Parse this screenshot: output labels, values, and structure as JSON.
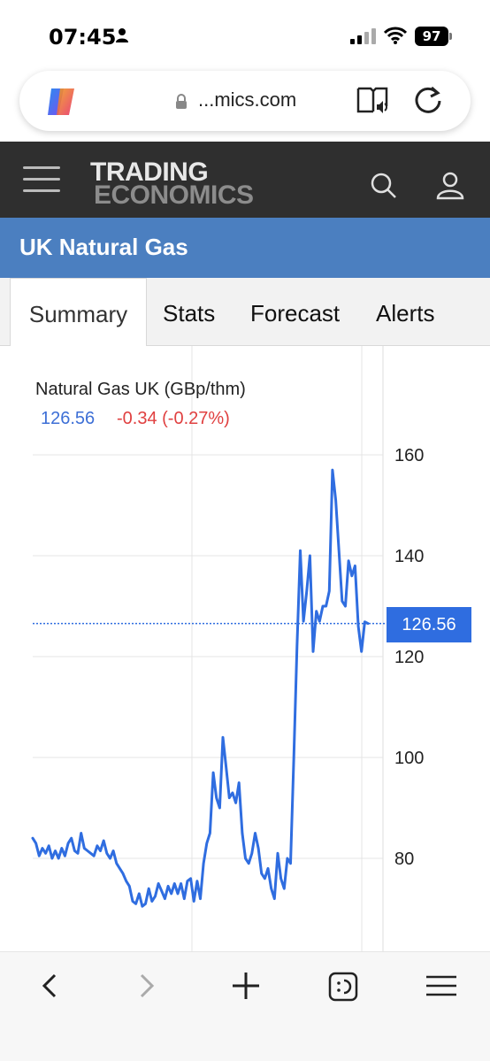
{
  "status": {
    "time": "07:45",
    "battery": "97"
  },
  "browser": {
    "url": "...mics.com"
  },
  "site": {
    "logo_top": "TRADING",
    "logo_bottom": "ECONOMICS"
  },
  "page": {
    "title": "UK Natural Gas"
  },
  "tabs": [
    {
      "label": "Summary",
      "active": true
    },
    {
      "label": "Stats",
      "active": false
    },
    {
      "label": "Forecast",
      "active": false
    },
    {
      "label": "Alerts",
      "active": false
    }
  ],
  "chart_header": {
    "title": "Natural Gas UK (GBp/thm)",
    "value": "126.56",
    "change": "-0.34 (-0.27%)"
  },
  "colors": {
    "line": "#2f6de0",
    "negative": "#e04040",
    "header": "#2f2f2f",
    "band": "#4b7fc0"
  },
  "chart_data": {
    "type": "line",
    "title": "Natural Gas UK (GBp/thm)",
    "xlabel": "",
    "ylabel": "",
    "ylim": [
      68,
      166
    ],
    "yticks": [
      80,
      100,
      120,
      140,
      160
    ],
    "grid": true,
    "current_value": 126.56,
    "current_label": "126.56",
    "series": [
      {
        "values": [
          84,
          83,
          80.5,
          82,
          81,
          82.5,
          80,
          81.5,
          80,
          82,
          80.5,
          83,
          84,
          81.5,
          81,
          85,
          82,
          81.5,
          81,
          80.5,
          82.5,
          81.5,
          83.5,
          81,
          80,
          81.5,
          79,
          78,
          77,
          75.5,
          74.5,
          71.5,
          71,
          73,
          70.5,
          71,
          74,
          71.5,
          72.5,
          75,
          73.5,
          72,
          74.5,
          73,
          75,
          73,
          75,
          72,
          75.5,
          76,
          71.5,
          75.5,
          72,
          79,
          83,
          85,
          97,
          92,
          90,
          104,
          98,
          92,
          93,
          91,
          95,
          85,
          80,
          79,
          81,
          85,
          82,
          77,
          76,
          78,
          74,
          72,
          81,
          76,
          74,
          80,
          79,
          100,
          122,
          141,
          127,
          133,
          140,
          121,
          129,
          127,
          130,
          130,
          133,
          157,
          151,
          141,
          131,
          130,
          139,
          136,
          138,
          126,
          121,
          126.9,
          126.56
        ]
      }
    ]
  },
  "icons": [
    "person-icon",
    "signal-icon",
    "wifi-icon",
    "copilot-icon",
    "lock-icon",
    "reader-icon",
    "reload-icon",
    "menu-icon",
    "search-icon",
    "user-icon",
    "back-icon",
    "forward-icon",
    "new-tab-icon",
    "tabs-icon",
    "menu-lines-icon"
  ]
}
